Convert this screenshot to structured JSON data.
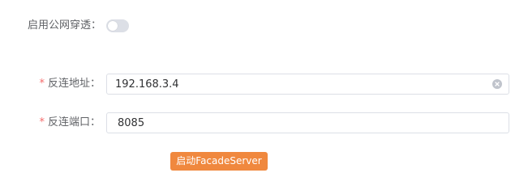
{
  "public_penetration": {
    "label": "启用公网穿透：",
    "enabled": false
  },
  "form": {
    "address": {
      "label": "反连地址：",
      "required_mark": "*",
      "value": "192.168.3.4"
    },
    "port": {
      "label": "反连端口：",
      "required_mark": "*",
      "value": "8085"
    }
  },
  "actions": {
    "start_label": "启动FacadeServer"
  },
  "colors": {
    "accent": "#f0883e",
    "required": "#f56c6c",
    "switch_off": "#dcdfe6"
  }
}
